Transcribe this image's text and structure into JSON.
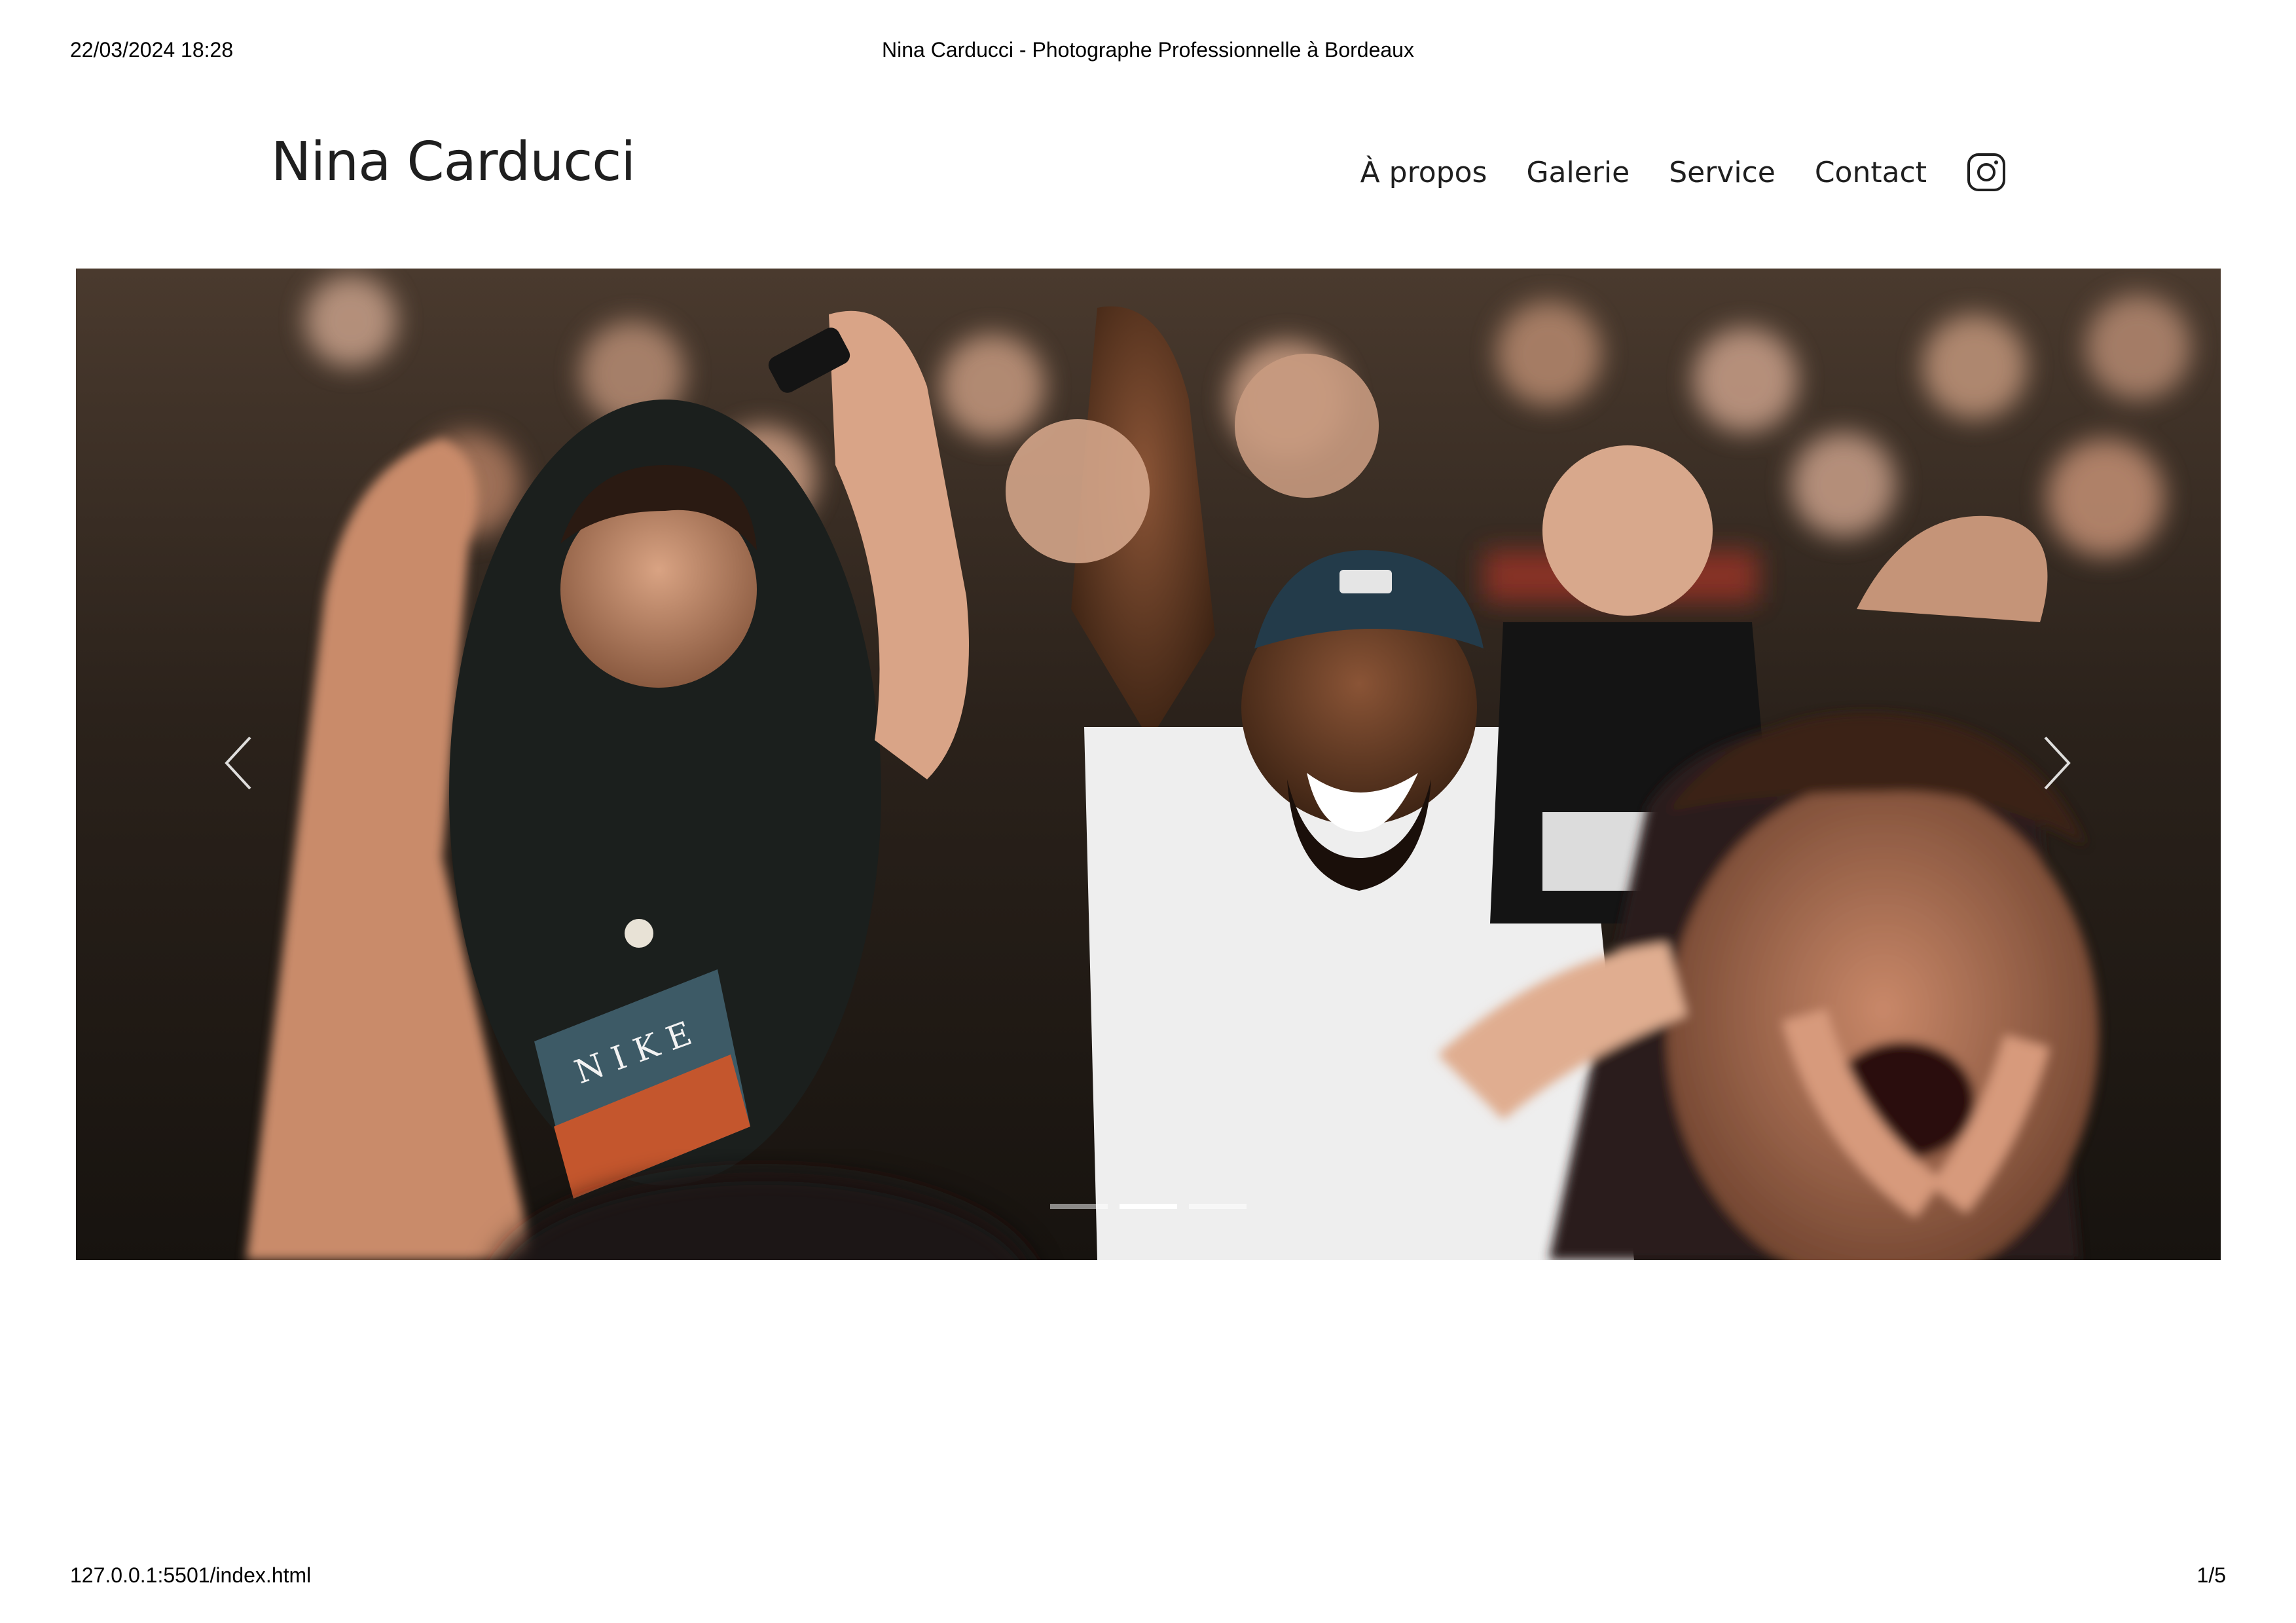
{
  "print": {
    "date": "22/03/2024 18:28",
    "title": "Nina Carducci - Photographe Professionnelle à Bordeaux",
    "url": "127.0.0.1:5501/index.html",
    "page": "1/5"
  },
  "header": {
    "brand": "Nina Carducci",
    "nav": [
      {
        "label": "À propos"
      },
      {
        "label": "Galerie"
      },
      {
        "label": "Service"
      },
      {
        "label": "Contact"
      }
    ],
    "social_icon": "instagram-icon"
  },
  "carousel": {
    "active_slide": 2,
    "slide_count": 3,
    "prev_icon": "chevron-left-icon",
    "next_icon": "chevron-right-icon"
  },
  "colors": {
    "text": "#1f1f1f",
    "indicator_active": "#ffffff"
  }
}
